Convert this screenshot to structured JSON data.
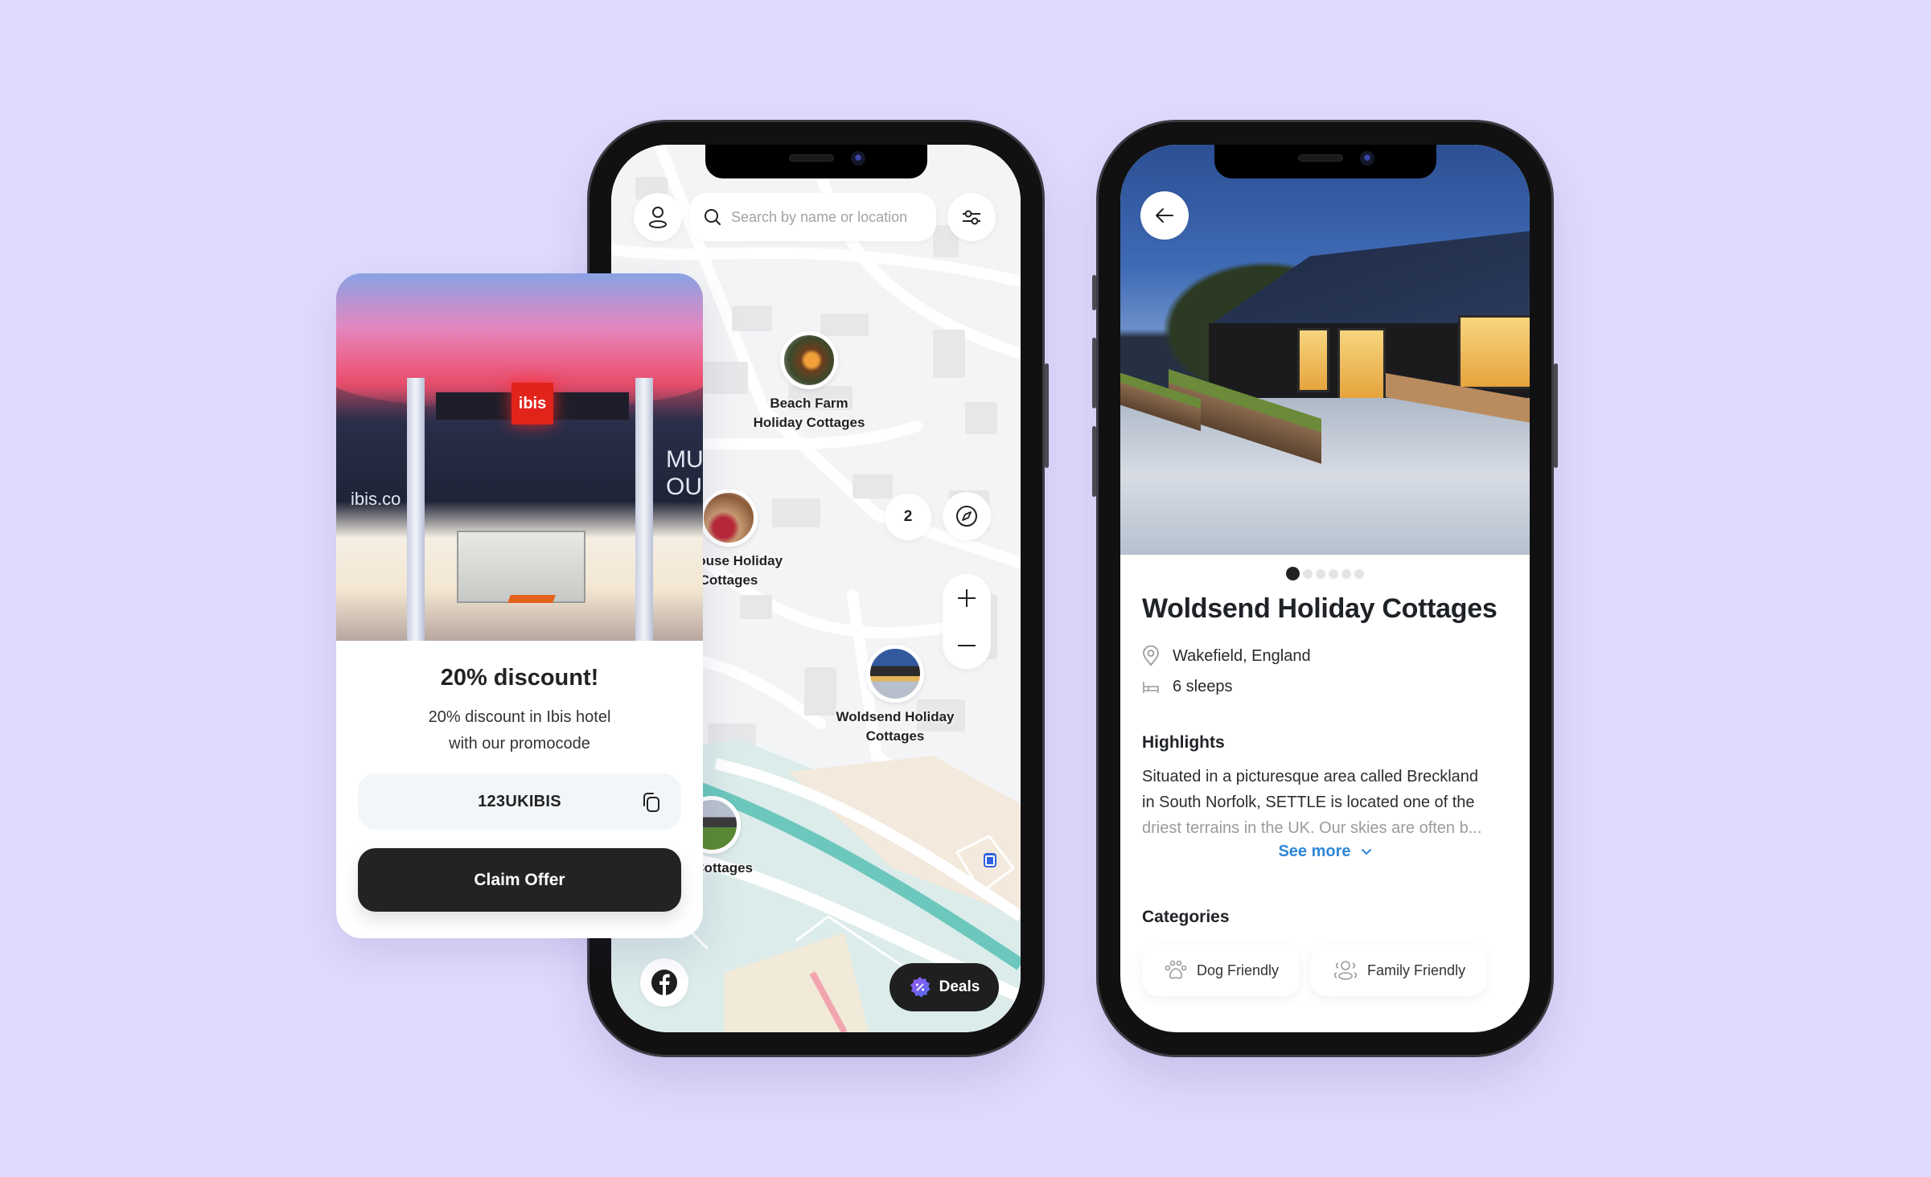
{
  "background_color": "#e0dbfd",
  "offer_card": {
    "image_alt": "ibis hotel entrance",
    "image_sign": {
      "logo": "ibis",
      "side_text_left": "ibis.co",
      "side_text_right": "MU\nOU"
    },
    "title": "20% discount!",
    "description_line1": "20% discount in Ibis hotel",
    "description_line2": "with our promocode",
    "promo_code": "123UKIBIS",
    "copy_icon": "copy-icon",
    "claim_button": "Claim Offer"
  },
  "map_screen": {
    "search": {
      "placeholder": "Search by name or location",
      "value": ""
    },
    "profile_icon": "user-icon",
    "filter_icon": "sliders-icon",
    "markers": [
      {
        "label": "Beach Farm\nHoliday Cottages"
      },
      {
        "label": "ff House Holiday\nCottages"
      },
      {
        "label": "Woldsend Holiday\nCottages"
      },
      {
        "label": "ate Cottages"
      }
    ],
    "cluster_count": "2",
    "compass_icon": "compass-icon",
    "zoom_in_icon": "plus-icon",
    "zoom_out_icon": "minus-icon",
    "facebook_icon": "facebook-icon",
    "deals_button": "Deals",
    "colors": {
      "water": "#6cc7bd",
      "deals_badge": "#7a5cf0"
    }
  },
  "detail_screen": {
    "back_icon": "arrow-left-icon",
    "pager": {
      "total": 6,
      "active": 1
    },
    "title": "Woldsend Holiday Cottages",
    "location": "Wakefield, England",
    "sleeps": "6 sleeps",
    "highlights_heading": "Highlights",
    "highlights_line1": "Situated in a picturesque area called Breckland",
    "highlights_line2": "in South Norfolk, SETTLE is located one of the",
    "highlights_line3": "driest terrains in the UK. Our skies are often b...",
    "see_more": "See more",
    "see_more_color": "#2d86d6",
    "categories_heading": "Categories",
    "categories": [
      {
        "label": "Dog Friendly",
        "icon": "paw-icon"
      },
      {
        "label": "Family Friendly",
        "icon": "family-icon"
      }
    ]
  }
}
